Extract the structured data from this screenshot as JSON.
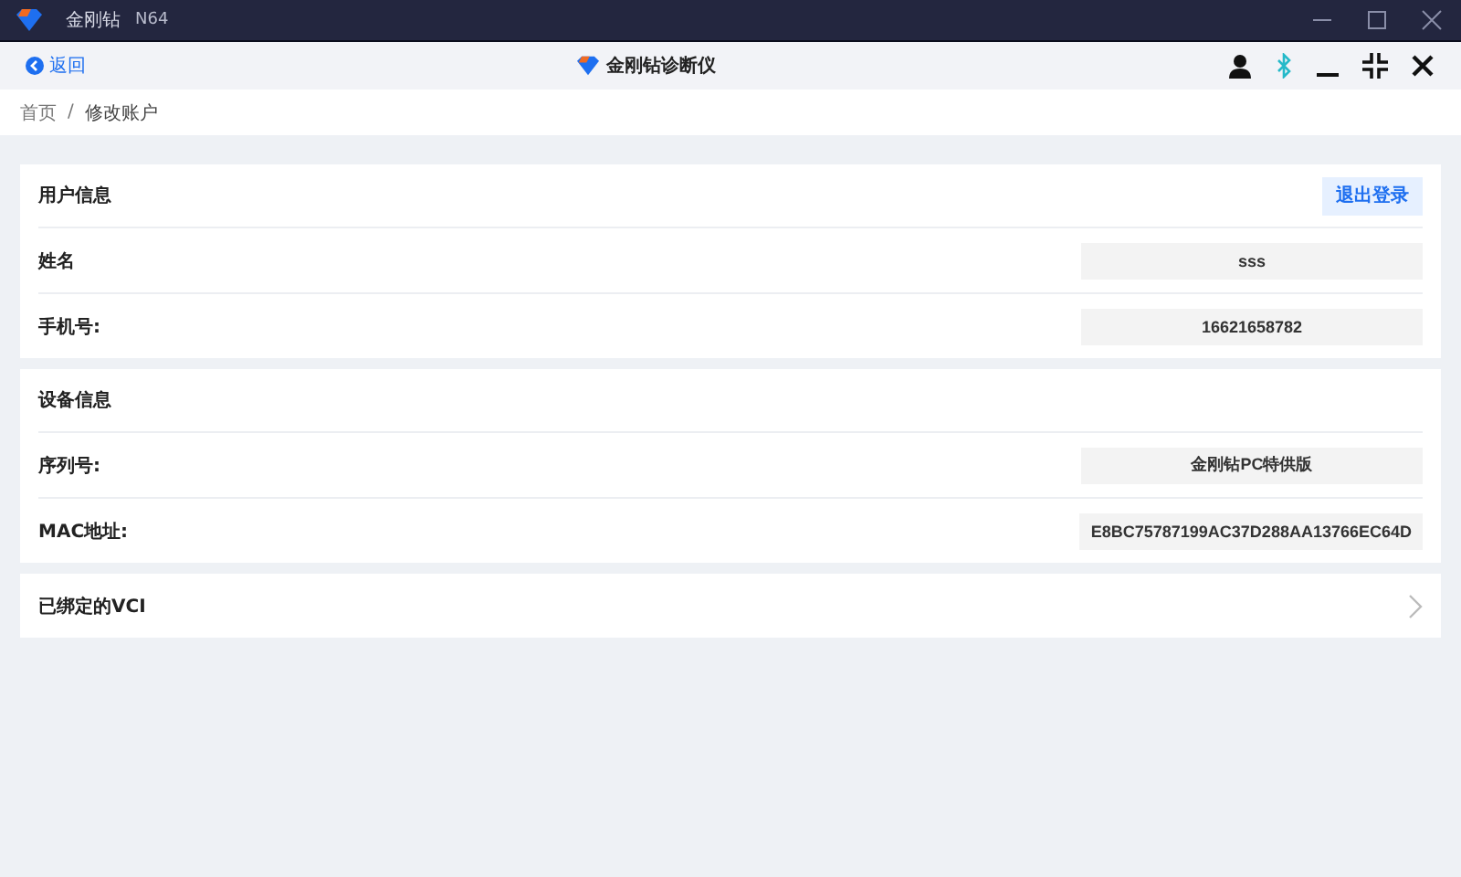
{
  "window": {
    "title": "金刚钻",
    "model": "N64"
  },
  "toolbar": {
    "back_label": "返回",
    "app_title": "金刚钻诊断仪"
  },
  "breadcrumb": {
    "items": [
      "首页",
      "修改账户"
    ],
    "separator": "/"
  },
  "sections": [
    {
      "kind": "info",
      "title": "用户信息",
      "action": "退出登录",
      "rows": [
        {
          "label": "姓名",
          "value": "sss"
        },
        {
          "label": "手机号:",
          "value": "16621658782"
        }
      ]
    },
    {
      "kind": "info",
      "title": "设备信息",
      "rows": [
        {
          "label": "序列号:",
          "value": "金刚钻PC特供版"
        },
        {
          "label": "MAC地址:",
          "value": "E8BC75787199AC37D288AA13766EC64D"
        }
      ]
    },
    {
      "kind": "link",
      "title": "已绑定的VCI"
    }
  ]
}
